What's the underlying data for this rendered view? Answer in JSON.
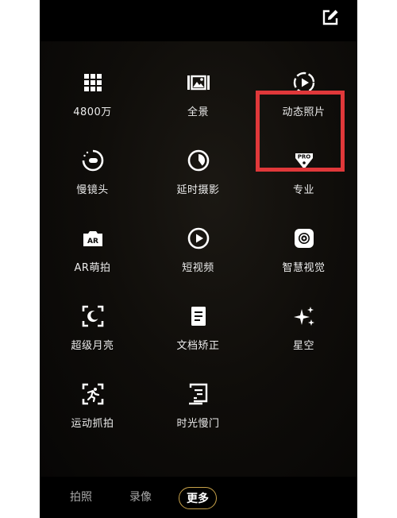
{
  "colors": {
    "background": "#050403",
    "label": "#ececec",
    "highlight_border": "#e0383a",
    "active_tab_border": "#c8a24a"
  },
  "header": {
    "edit_icon": "edit-icon"
  },
  "modes": [
    {
      "label": "4800万",
      "icon": "grid-dots-icon"
    },
    {
      "label": "全景",
      "icon": "panorama-icon"
    },
    {
      "label": "动态照片",
      "icon": "live-photo-icon"
    },
    {
      "label": "慢镜头",
      "icon": "slow-motion-icon"
    },
    {
      "label": "延时摄影",
      "icon": "time-lapse-icon"
    },
    {
      "label": "专业",
      "icon": "pro-icon"
    },
    {
      "label": "AR萌拍",
      "icon": "ar-icon"
    },
    {
      "label": "短视频",
      "icon": "play-circle-icon"
    },
    {
      "label": "智慧视觉",
      "icon": "smart-vision-icon"
    },
    {
      "label": "超级月亮",
      "icon": "super-moon-icon"
    },
    {
      "label": "文档矫正",
      "icon": "document-icon"
    },
    {
      "label": "星空",
      "icon": "starry-sky-icon"
    },
    {
      "label": "运动抓拍",
      "icon": "motion-capture-icon"
    },
    {
      "label": "时光慢门",
      "icon": "slow-shutter-icon"
    }
  ],
  "highlighted_mode": "动态照片",
  "bottom_tabs": {
    "photo": "拍照",
    "video": "录像",
    "more": "更多"
  },
  "active_tab": "更多"
}
